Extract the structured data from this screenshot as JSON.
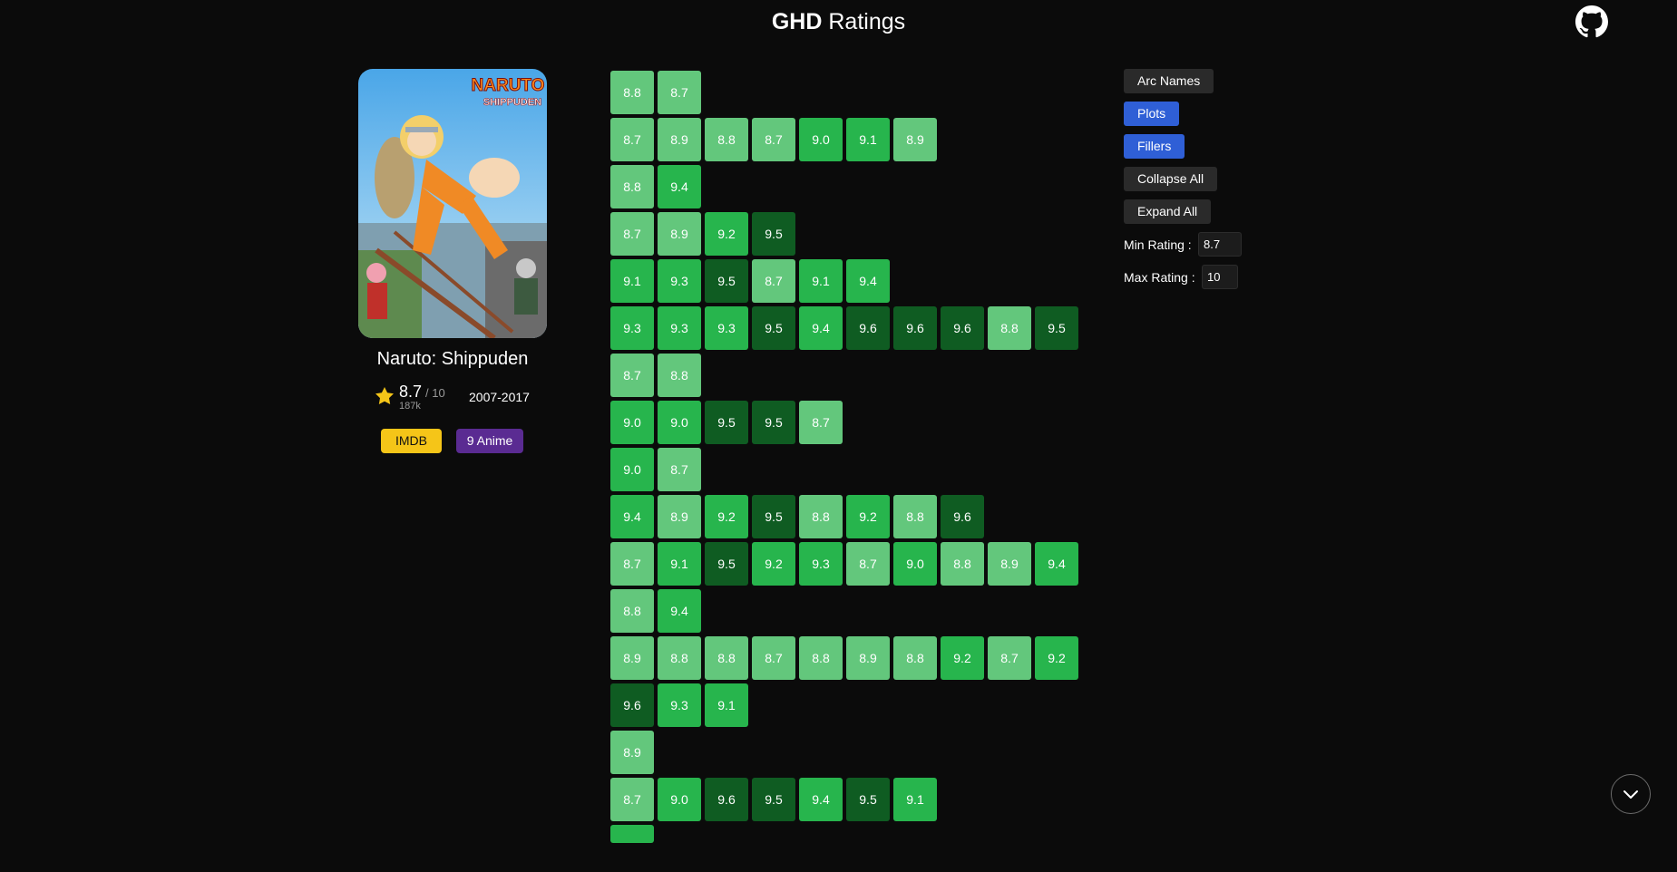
{
  "header": {
    "brand": "GHD",
    "title": "Ratings"
  },
  "show": {
    "title": "Naruto: Shippuden",
    "rating": "8.7",
    "rating_out_of": "/ 10",
    "votes": "187k",
    "years": "2007-2017",
    "links": [
      {
        "label": "IMDB"
      },
      {
        "label": "9 Anime"
      }
    ],
    "poster_logo_line1": "NARUTO",
    "poster_logo_line2": "SHIPPUDEN"
  },
  "controls": {
    "buttons": [
      {
        "label": "Arc Names",
        "active": false
      },
      {
        "label": "Plots",
        "active": true
      },
      {
        "label": "Fillers",
        "active": true
      },
      {
        "label": "Collapse All",
        "active": false
      },
      {
        "label": "Expand All",
        "active": false
      }
    ],
    "min_rating_label": "Min Rating :",
    "min_rating_value": "8.7",
    "max_rating_label": "Max Rating :",
    "max_rating_value": "10"
  },
  "colors": {
    "low": "#63c77c",
    "mid": "#27b54d",
    "high": "#0f5c22",
    "accent": "#2f5fd6",
    "imdb": "#f5c518",
    "anime": "#5a2b92"
  },
  "rating_rows": [
    [
      "8.8",
      "8.7"
    ],
    [
      "8.7",
      "8.9",
      "8.8",
      "8.7",
      "9.0",
      "9.1",
      "8.9"
    ],
    [
      "8.8",
      "9.4"
    ],
    [
      "8.7",
      "8.9",
      "9.2",
      "9.5"
    ],
    [
      "9.1",
      "9.3",
      "9.5",
      "8.7",
      "9.1",
      "9.4"
    ],
    [
      "9.3",
      "9.3",
      "9.3",
      "9.5",
      "9.4",
      "9.6",
      "9.6",
      "9.6",
      "8.8",
      "9.5"
    ],
    [
      "8.7",
      "8.8"
    ],
    [
      "9.0",
      "9.0",
      "9.5",
      "9.5",
      "8.7"
    ],
    [
      "9.0",
      "8.7"
    ],
    [
      "9.4",
      "8.9",
      "9.2",
      "9.5",
      "8.8",
      "9.2",
      "8.8",
      "9.6"
    ],
    [
      "8.7",
      "9.1",
      "9.5",
      "9.2",
      "9.3",
      "8.7",
      "9.0",
      "8.8",
      "8.9",
      "9.4"
    ],
    [
      "8.8",
      "9.4"
    ],
    [
      "8.9",
      "8.8",
      "8.8",
      "8.7",
      "8.8",
      "8.9",
      "8.8",
      "9.2",
      "8.7",
      "9.2"
    ],
    [
      "9.6",
      "9.3",
      "9.1"
    ],
    [
      "8.9"
    ],
    [
      "8.7",
      "9.0",
      "9.6",
      "9.5",
      "9.4",
      "9.5",
      "9.1"
    ],
    [
      ""
    ]
  ],
  "icons": {
    "github": "github-icon",
    "star": "star-icon",
    "scroll": "chevron-down-icon"
  }
}
